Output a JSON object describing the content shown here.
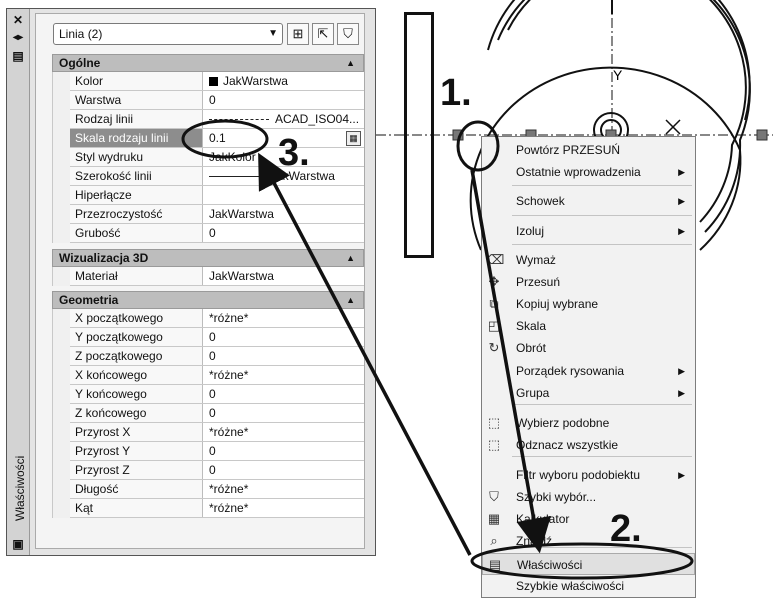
{
  "palette": {
    "vertical_title": "Właściwości",
    "selector_value": "Linia (2)",
    "sections": [
      {
        "title": "Ogólne",
        "rows": [
          {
            "label": "Kolor",
            "value": "JakWarstwa",
            "swatch": "#000000"
          },
          {
            "label": "Warstwa",
            "value": "0"
          },
          {
            "label": "Rodzaj linii",
            "value": "ACAD_ISO04..."
          },
          {
            "label": "Skala rodzaju linii",
            "value": "0.1"
          },
          {
            "label": "Styl wydruku",
            "value": "JakKolor"
          },
          {
            "label": "Szerokość linii",
            "value": "JakWarstwa"
          },
          {
            "label": "Hiperłącze",
            "value": ""
          },
          {
            "label": "Przezroczystość",
            "value": "JakWarstwa"
          },
          {
            "label": "Grubość",
            "value": "0"
          }
        ]
      },
      {
        "title": "Wizualizacja 3D",
        "rows": [
          {
            "label": "Materiał",
            "value": "JakWarstwa"
          }
        ]
      },
      {
        "title": "Geometria",
        "rows": [
          {
            "label": "X początkowego",
            "value": "*różne*"
          },
          {
            "label": "Y początkowego",
            "value": "0"
          },
          {
            "label": "Z początkowego",
            "value": "0"
          },
          {
            "label": "X końcowego",
            "value": "*różne*"
          },
          {
            "label": "Y końcowego",
            "value": "0"
          },
          {
            "label": "Z końcowego",
            "value": "0"
          },
          {
            "label": "Przyrost X",
            "value": "*różne*"
          },
          {
            "label": "Przyrost Y",
            "value": "0"
          },
          {
            "label": "Przyrost Z",
            "value": "0"
          },
          {
            "label": "Długość",
            "value": "*różne*"
          },
          {
            "label": "Kąt",
            "value": "*różne*"
          }
        ]
      }
    ]
  },
  "menu": {
    "items": [
      {
        "label": "Powtórz PRZESUŃ",
        "icon": ""
      },
      {
        "label": "Ostatnie wprowadzenia",
        "submenu": true
      },
      {
        "label": "Schowek",
        "submenu": true
      },
      {
        "label": "Izoluj",
        "submenu": true
      },
      {
        "label": "Wymaż",
        "icon": "eraser-icon"
      },
      {
        "label": "Przesuń",
        "icon": "move-icon"
      },
      {
        "label": "Kopiuj wybrane",
        "icon": "copy-icon"
      },
      {
        "label": "Skala",
        "icon": "scale-icon"
      },
      {
        "label": "Obrót",
        "icon": "rotate-icon"
      },
      {
        "label": "Porządek rysowania",
        "submenu": true
      },
      {
        "label": "Grupa",
        "submenu": true
      },
      {
        "label": "Wybierz podobne",
        "icon": "select-similar-icon"
      },
      {
        "label": "Odznacz wszystkie",
        "icon": "deselect-icon"
      },
      {
        "label": "Filtr wyboru podobiektu",
        "submenu": true
      },
      {
        "label": "Szybki wybór...",
        "icon": "quick-select-icon"
      },
      {
        "label": "Kalkulator",
        "icon": "calculator-icon"
      },
      {
        "label": "Znajdź...",
        "icon": "find-icon"
      },
      {
        "label": "Właściwości",
        "icon": "properties-icon"
      },
      {
        "label": "Szybkie właściwości"
      }
    ]
  },
  "callouts": {
    "one": "1.",
    "two": "2.",
    "three": "3."
  },
  "drawing": {
    "axis_label": "Y"
  }
}
